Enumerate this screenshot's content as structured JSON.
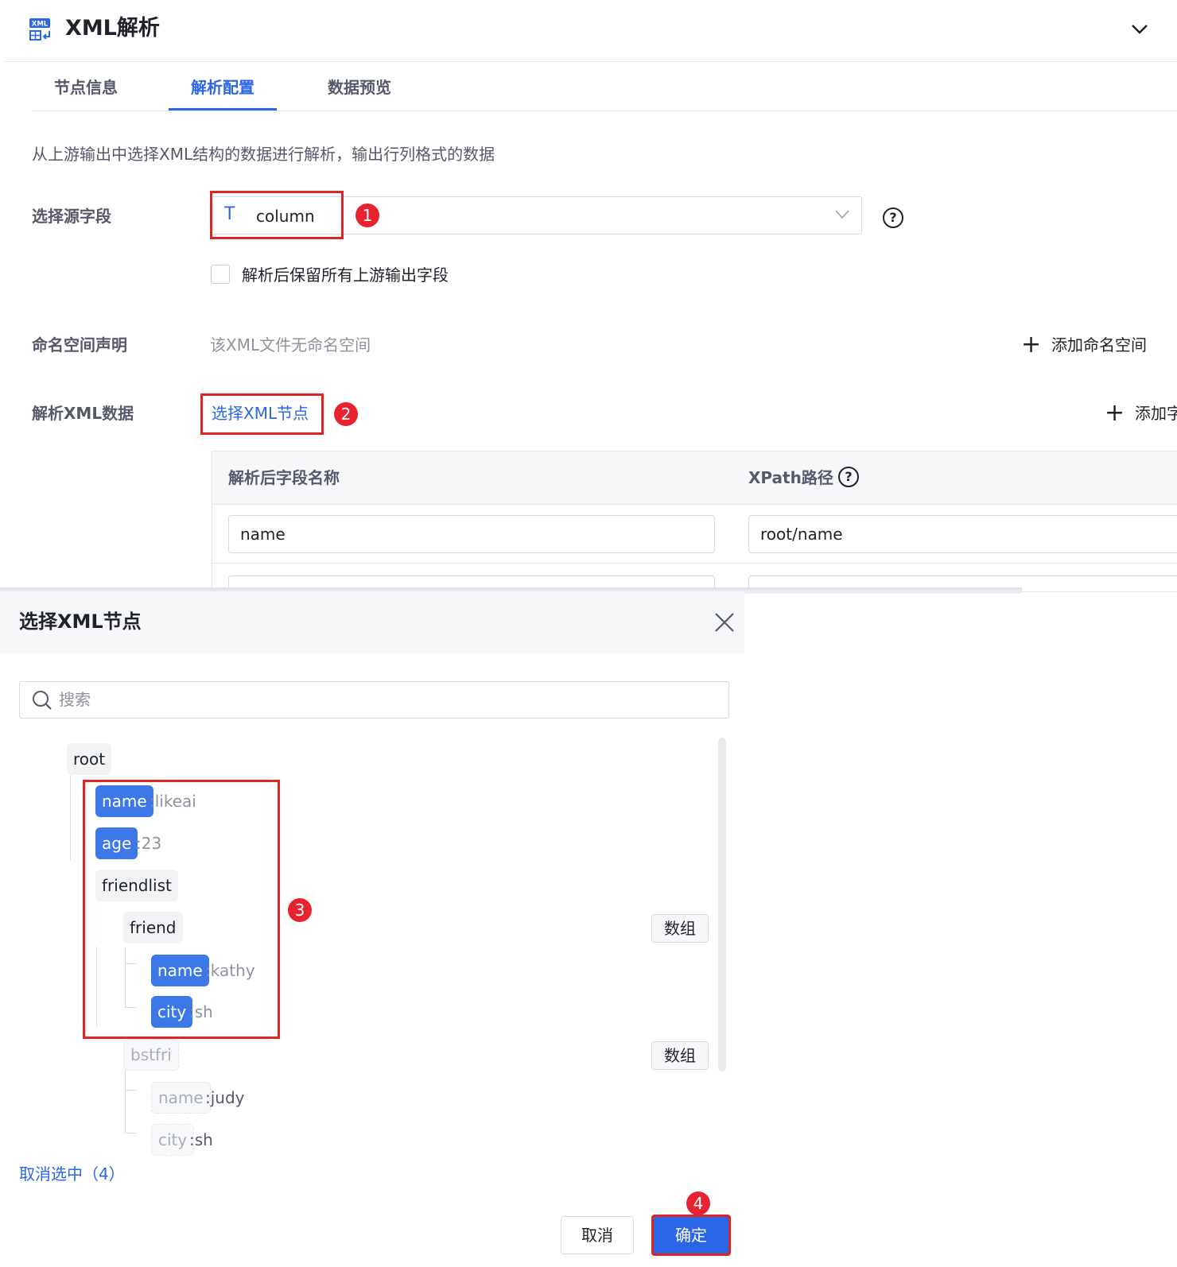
{
  "header": {
    "icon_label": "XML",
    "title": "XML解析",
    "collapse_icon": "chevron-down-icon"
  },
  "tabs": [
    {
      "label": "节点信息",
      "active": false
    },
    {
      "label": "解析配置",
      "active": true
    },
    {
      "label": "数据预览",
      "active": false
    }
  ],
  "description": "从上游输出中选择XML结构的数据进行解析，输出行列格式的数据",
  "source_field": {
    "label": "选择源字段",
    "type_icon": "T",
    "value": "column",
    "help_icon": "?"
  },
  "keep_fields": {
    "checked": false,
    "label": "解析后保留所有上游输出字段"
  },
  "namespace": {
    "label": "命名空间声明",
    "empty_text": "该XML文件无命名空间",
    "add_label": "添加命名空间"
  },
  "parse": {
    "label": "解析XML数据",
    "select_node_link": "选择XML节点",
    "add_label": "添加字"
  },
  "table": {
    "columns": [
      "解析后字段名称",
      "XPath路径"
    ],
    "help_icon": "?",
    "rows": [
      {
        "field_name": "name",
        "xpath": "root/name"
      }
    ]
  },
  "annotations": [
    "1",
    "2",
    "3",
    "4"
  ],
  "dialog": {
    "title": "选择XML节点",
    "search_placeholder": "搜索",
    "tree": {
      "root": "root",
      "name_tag": "name",
      "name_value": ":likeai",
      "age_tag": "age",
      "age_value": ":23",
      "friendlist_tag": "friendlist",
      "friend_tag": "friend",
      "friend_name_tag": "name",
      "friend_name_value": ":kathy",
      "friend_city_tag": "city",
      "friend_city_value": ":sh",
      "bstfri_tag": "bstfri",
      "bstfri_name_tag": "name",
      "bstfri_name_value": ":judy",
      "bstfri_city_tag": "city",
      "bstfri_city_value": ":sh",
      "array_label": "数组"
    },
    "deselect": "取消选中（4）",
    "cancel": "取消",
    "confirm": "确定"
  },
  "colors": {
    "primary": "#2c66e8",
    "selected_tag": "#3d78e8",
    "annotation_red": "#e02424"
  }
}
